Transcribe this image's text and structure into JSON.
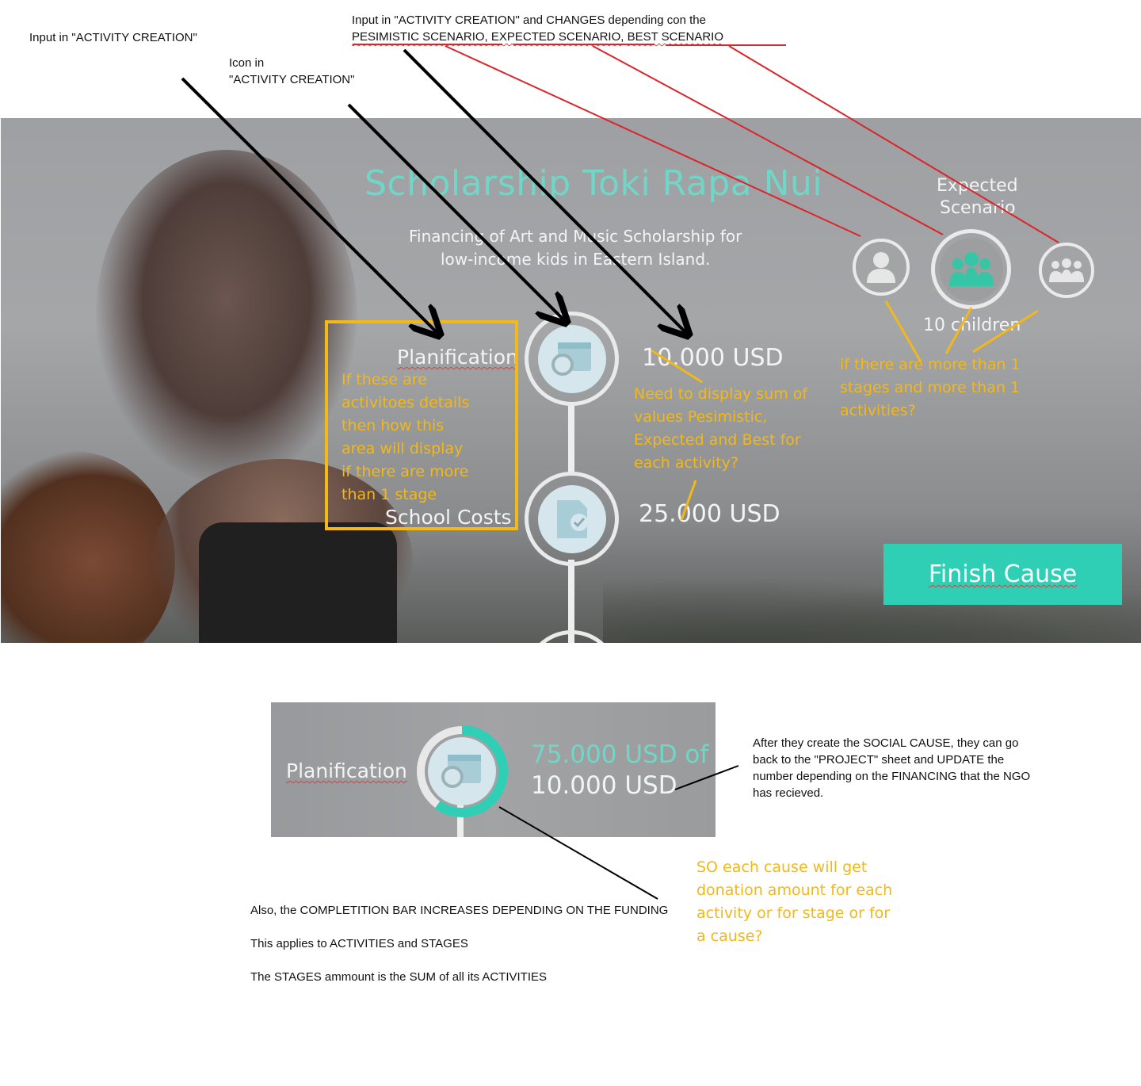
{
  "annotations": {
    "activity_input_note": "Input in \"ACTIVITY CREATION\"",
    "icon_note_line1": "Icon in",
    "icon_note_line2": "\"ACTIVITY CREATION\"",
    "scenario_note_line1": "Input in \"ACTIVITY CREATION\" and CHANGES depending con the",
    "scenario_pesimistic": "PESIMISTIC SCENARIO,",
    "scenario_expected": "EXPECTED SCENARIO,",
    "scenario_best": "BEST SCENARIO",
    "after_create_note": [
      "After they create the SOCIAL CAUSE, they can go",
      "back to the \"PROJECT\" sheet and UPDATE the",
      "number depending on the FINANCING that the NGO",
      "has recieved."
    ],
    "completion_note": "Also, the COMPLETITION BAR INCREASES DEPENDING ON THE FUNDING",
    "applies_note": "This applies to ACTIVITIES and STAGES",
    "stages_sum_note": "The STAGES ammount is the SUM of all its ACTIVITIES"
  },
  "questions": {
    "stage_area": [
      "If these are",
      "activitoes details",
      "then how this",
      "area  will display",
      "if there are more",
      "than 1 stage"
    ],
    "sum_values": [
      "Need to display sum of",
      "values  Pesimistic,",
      "Expected and Best for",
      "each activity?"
    ],
    "more_stages": [
      "if there are more than 1",
      "stages and more than 1",
      "activities?"
    ],
    "donation": [
      "SO each cause will get",
      "donation amount for each",
      "activity or for stage or for",
      "a cause?"
    ]
  },
  "cause": {
    "title": "Scholarship Toki Rapa Nui",
    "description_line1": "Financing of Art and Music Scholarship for",
    "description_line2": "low-income kids in Eastern Island.",
    "scenario_label_line1": "Expected",
    "scenario_label_line2": "Scenario",
    "beneficiaries": "10 children",
    "finish_button": "Finish Cause"
  },
  "stages": [
    {
      "label": "Planification",
      "amount": "10.000 USD",
      "icon": "calendar-icon"
    },
    {
      "label": "School Costs",
      "amount": "25.000 USD",
      "icon": "document-check-icon"
    }
  ],
  "progress_card": {
    "label": "Planification",
    "funded": "75.000 USD of",
    "goal": "10.000 USD",
    "progress_fraction": 0.6,
    "colors": {
      "ring_start": "#2a9bb0",
      "ring_end": "#2ecfb5",
      "funded_text": "#6fd6c8"
    }
  },
  "colors": {
    "accent": "#2ecfb5",
    "highlight_box": "#f5b914",
    "question_text": "#f2b81b",
    "arrow_red": "#d8262c"
  }
}
